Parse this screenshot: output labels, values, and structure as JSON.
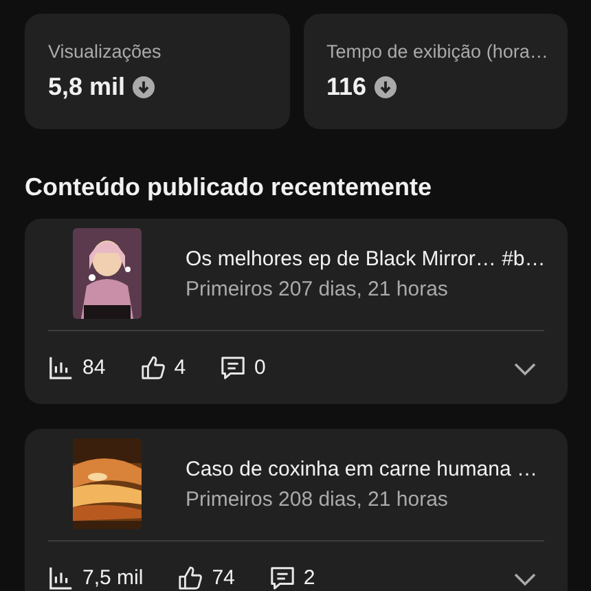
{
  "stats": [
    {
      "label": "Visualizações",
      "value": "5,8 mil"
    },
    {
      "label": "Tempo de exibição (hora…",
      "value": "116"
    }
  ],
  "section_title": "Conteúdo publicado recentemente",
  "videos": [
    {
      "title": "Os melhores ep de Black Mirror… #b…",
      "subtitle": "Primeiros 207 dias, 21 horas",
      "views": "84",
      "likes": "4",
      "comments": "0"
    },
    {
      "title": "Caso de coxinha em carne humana …",
      "subtitle": "Primeiros 208 dias, 21 horas",
      "views": "7,5 mil",
      "likes": "74",
      "comments": "2"
    }
  ]
}
